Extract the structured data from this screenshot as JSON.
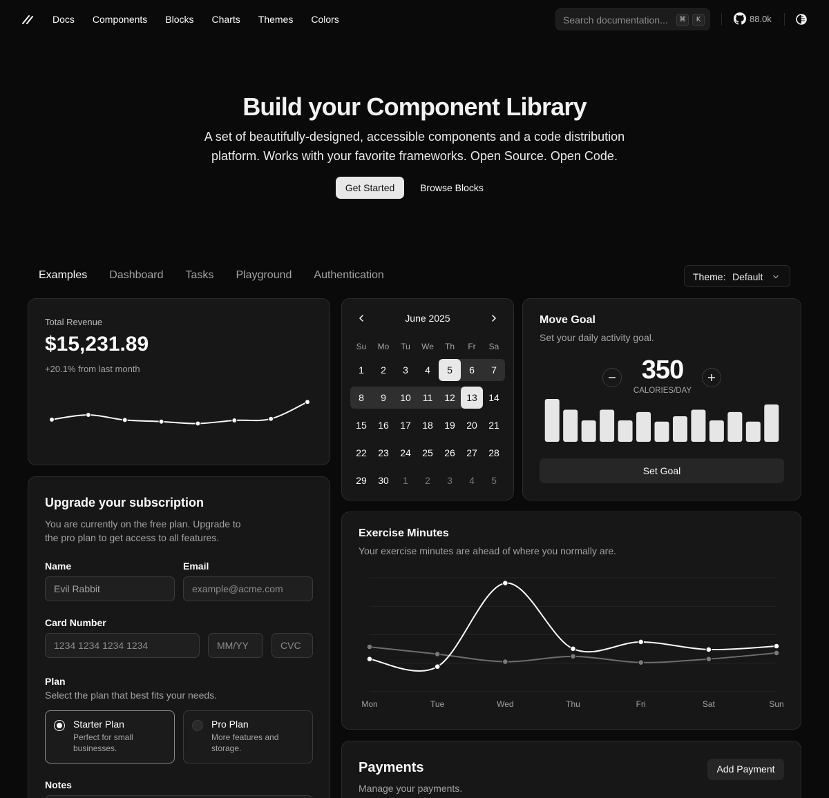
{
  "header": {
    "nav": [
      "Docs",
      "Components",
      "Blocks",
      "Charts",
      "Themes",
      "Colors"
    ],
    "search_placeholder": "Search documentation...",
    "kbd_cmd": "⌘",
    "kbd_k": "K",
    "github_stars": "88.0k"
  },
  "hero": {
    "title": "Build your Component Library",
    "subtitle": "A set of beautifully-designed, accessible components and a code distribution platform. Works with your favorite frameworks. Open Source. Open Code.",
    "primary_button": "Get Started",
    "secondary_button": "Browse Blocks"
  },
  "tabs": {
    "items": [
      "Examples",
      "Dashboard",
      "Tasks",
      "Playground",
      "Authentication"
    ],
    "active": "Examples",
    "theme_label": "Theme:",
    "theme_value": "Default"
  },
  "revenue": {
    "label": "Total Revenue",
    "value": "$15,231.89",
    "delta": "+20.1% from last month",
    "chart_data": {
      "type": "line",
      "values": [
        60,
        72,
        59,
        55,
        50,
        58,
        62,
        105
      ],
      "ylim": [
        0,
        130
      ]
    }
  },
  "calendar": {
    "month": "June 2025",
    "weekdays": [
      "Su",
      "Mo",
      "Tu",
      "We",
      "Th",
      "Fr",
      "Sa"
    ],
    "weeks": [
      [
        "1",
        "2",
        "3",
        "4",
        "5",
        "6",
        "7"
      ],
      [
        "8",
        "9",
        "10",
        "11",
        "12",
        "13",
        "14"
      ],
      [
        "15",
        "16",
        "17",
        "18",
        "19",
        "20",
        "21"
      ],
      [
        "22",
        "23",
        "24",
        "25",
        "26",
        "27",
        "28"
      ],
      [
        "29",
        "30",
        "1",
        "2",
        "3",
        "4",
        "5"
      ]
    ],
    "range_start": "5",
    "range_end": "13"
  },
  "move_goal": {
    "title": "Move Goal",
    "subtitle": "Set your daily activity goal.",
    "value": "350",
    "unit": "CALORIES/DAY",
    "button": "Set Goal",
    "chart_data": {
      "type": "bar",
      "values": [
        400,
        300,
        200,
        300,
        200,
        278,
        189,
        239,
        300,
        200,
        278,
        189,
        349
      ],
      "ylim": [
        0,
        400
      ]
    }
  },
  "exercise": {
    "title": "Exercise Minutes",
    "subtitle": "Your exercise minutes are ahead of where you normally are.",
    "chart_data": {
      "type": "line",
      "categories": [
        "Mon",
        "Tue",
        "Wed",
        "Thu",
        "Fri",
        "Sat",
        "Sun"
      ],
      "series": [
        {
          "values": [
            186,
            166,
            386,
            213,
            231,
            211,
            220
          ]
        },
        {
          "values": [
            218,
            199,
            179,
            193,
            177,
            186,
            202
          ]
        }
      ],
      "ylim": [
        100,
        400
      ]
    }
  },
  "upgrade": {
    "title": "Upgrade your subscription",
    "subtitle": "You are currently on the free plan. Upgrade to the pro plan to get access to all features.",
    "name_label": "Name",
    "name_value": "Evil Rabbit",
    "email_label": "Email",
    "email_placeholder": "example@acme.com",
    "card_label": "Card Number",
    "card_placeholder": "1234 1234 1234 1234",
    "expiry_placeholder": "MM/YY",
    "cvc_placeholder": "CVC",
    "plan_label": "Plan",
    "plan_sub": "Select the plan that best fits your needs.",
    "plans": [
      {
        "name": "Starter Plan",
        "desc": "Perfect for small businesses."
      },
      {
        "name": "Pro Plan",
        "desc": "More features and storage."
      }
    ],
    "notes_label": "Notes"
  },
  "payments": {
    "title": "Payments",
    "subtitle": "Manage your payments.",
    "button": "Add Payment"
  }
}
